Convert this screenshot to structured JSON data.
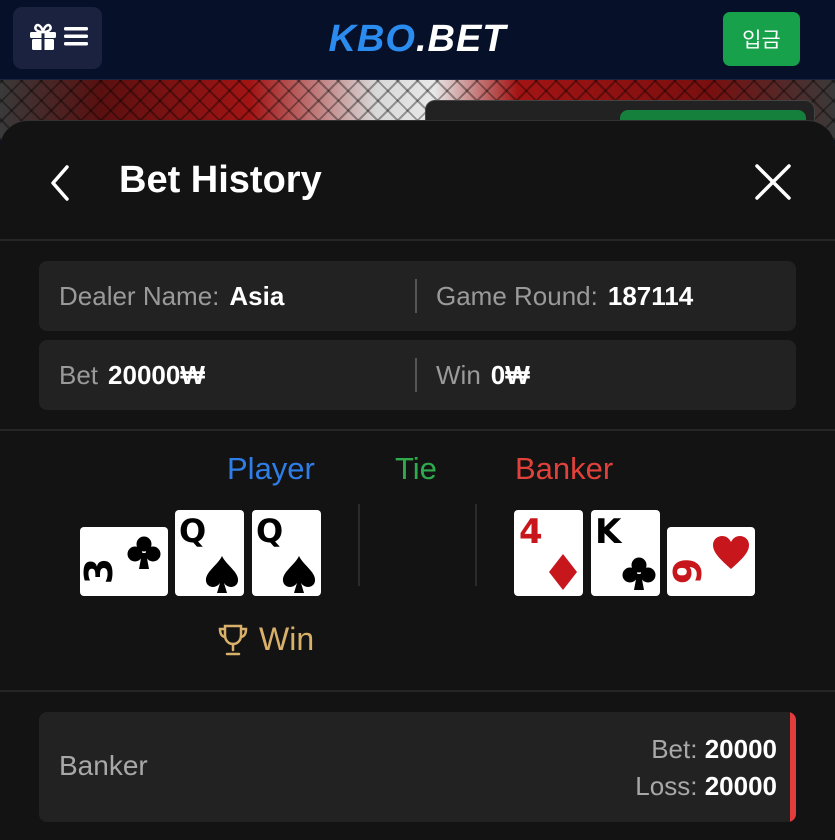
{
  "topbar": {
    "menu_icons": [
      "gift-icon",
      "hamburger-icon"
    ],
    "logo_part1": "KBO",
    "logo_part2": ".BET",
    "deposit_label": "입금",
    "colors": {
      "logo_blue": "#2b8cf0",
      "deposit_green": "#16a14a"
    }
  },
  "sheet": {
    "title": "Bet History",
    "back_icon": "chevron-left-icon",
    "close_icon": "close-icon"
  },
  "info": {
    "dealer_label": "Dealer Name:",
    "dealer_value": "Asia",
    "round_label": "Game Round:",
    "round_value": "187114",
    "bet_label": "Bet",
    "bet_value": "20000₩",
    "win_label": "Win",
    "win_value": "0₩"
  },
  "game": {
    "player_label": "Player",
    "tie_label": "Tie",
    "banker_label": "Banker",
    "colors": {
      "player": "#2f7ee8",
      "tie": "#2faa4c",
      "banker": "#e0413a"
    },
    "player_cards": [
      {
        "rank": "3",
        "suit": "clubs",
        "rotated": true
      },
      {
        "rank": "Q",
        "suit": "spades",
        "rotated": false
      },
      {
        "rank": "Q",
        "suit": "spades",
        "rotated": false
      }
    ],
    "banker_cards": [
      {
        "rank": "4",
        "suit": "diamonds",
        "rotated": false
      },
      {
        "rank": "K",
        "suit": "clubs",
        "rotated": false
      },
      {
        "rank": "9",
        "suit": "hearts",
        "rotated": true
      }
    ],
    "winner_icon": "trophy-icon",
    "winner_text": "Win"
  },
  "result": {
    "side": "Banker",
    "bet_label": "Bet:",
    "bet_value": "20000",
    "loss_label": "Loss:",
    "loss_value": "20000",
    "status_color": "#e23c3c"
  }
}
